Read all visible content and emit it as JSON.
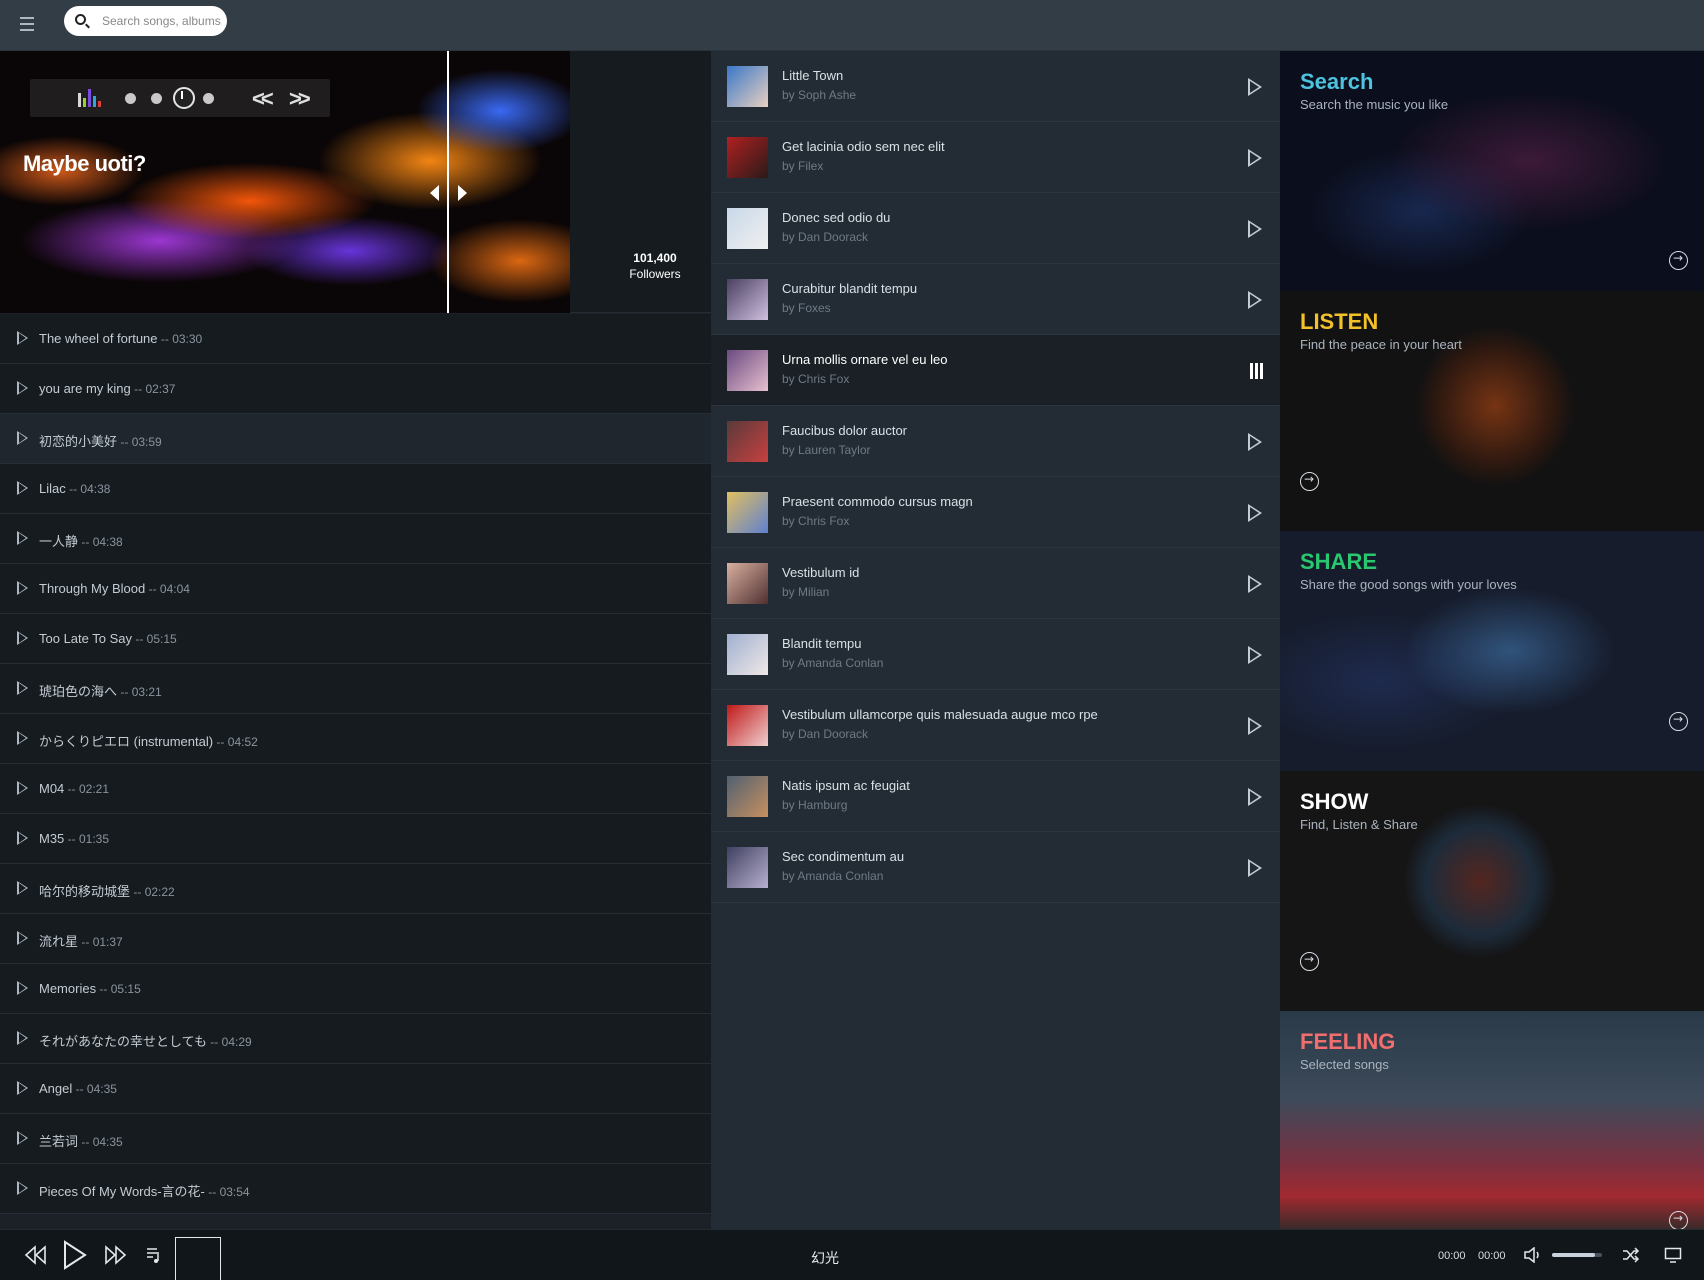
{
  "header": {
    "search_placeholder": "Search songs, albums..."
  },
  "hero": {
    "title": "Maybe uoti?",
    "followers_count": "101,400",
    "followers_label": "Followers"
  },
  "tracks": [
    {
      "name": "The wheel of fortune",
      "duration": "03:30"
    },
    {
      "name": "you are my king",
      "duration": "02:37"
    },
    {
      "name": "初恋的小美好",
      "duration": "03:59"
    },
    {
      "name": "Lilac",
      "duration": "04:38"
    },
    {
      "name": "一人静",
      "duration": "04:38"
    },
    {
      "name": "Through My Blood",
      "duration": "04:04"
    },
    {
      "name": "Too Late To Say",
      "duration": "05:15"
    },
    {
      "name": "琥珀色の海へ",
      "duration": "03:21"
    },
    {
      "name": "からくりピエロ (instrumental)",
      "duration": "04:52"
    },
    {
      "name": "M04",
      "duration": "02:21"
    },
    {
      "name": "M35",
      "duration": "01:35"
    },
    {
      "name": "哈尔的移动城堡",
      "duration": "02:22"
    },
    {
      "name": "流れ星",
      "duration": "01:37"
    },
    {
      "name": "Memories",
      "duration": "05:15"
    },
    {
      "name": "それがあなたの幸せとしても",
      "duration": "04:29"
    },
    {
      "name": "Angel",
      "duration": "04:35"
    },
    {
      "name": "兰若词",
      "duration": "04:35"
    },
    {
      "name": "Pieces Of My Words-言の花-",
      "duration": "03:54"
    }
  ],
  "highlighted_track_index": 2,
  "songs": [
    {
      "title": "Little Town",
      "artist": "by Soph Ashe"
    },
    {
      "title": "Get lacinia odio sem nec elit",
      "artist": "by Filex"
    },
    {
      "title": "Donec sed odio du",
      "artist": "by Dan Doorack"
    },
    {
      "title": "Curabitur blandit tempu",
      "artist": "by Foxes"
    },
    {
      "title": "Urna mollis ornare vel eu leo",
      "artist": "by Chris Fox"
    },
    {
      "title": "Faucibus dolor auctor",
      "artist": "by Lauren Taylor"
    },
    {
      "title": "Praesent commodo cursus magn",
      "artist": "by Chris Fox"
    },
    {
      "title": "Vestibulum id",
      "artist": "by Milian"
    },
    {
      "title": "Blandit tempu",
      "artist": "by Amanda Conlan"
    },
    {
      "title": "Vestibulum ullamcorpe quis malesuada augue mco rpe",
      "artist": "by Dan Doorack"
    },
    {
      "title": "Natis ipsum ac feugiat",
      "artist": "by Hamburg"
    },
    {
      "title": "Sec condimentum au",
      "artist": "by Amanda Conlan"
    }
  ],
  "active_song_index": 4,
  "cards": [
    {
      "title": "Search",
      "subtitle": "Search the music you like",
      "color": "#4dc3e0"
    },
    {
      "title": "LISTEN",
      "subtitle": "Find the peace in your heart",
      "color": "#f2c029"
    },
    {
      "title": "SHARE",
      "subtitle": "Share the good songs with your loves",
      "color": "#29c76f"
    },
    {
      "title": "SHOW",
      "subtitle": "Find, Listen & Share",
      "color": "#ffffff"
    },
    {
      "title": "FEELING",
      "subtitle": "Selected songs",
      "color": "#f06e6e"
    }
  ],
  "player": {
    "now_playing": "幻光",
    "current_time": "00:00",
    "total_time": "00:00",
    "volume_level": 0.85,
    "icons": [
      "rewind-icon",
      "play-icon",
      "fast-forward-icon",
      "playlist-icon",
      "volume-icon",
      "shuffle-icon",
      "screen-icon"
    ]
  }
}
